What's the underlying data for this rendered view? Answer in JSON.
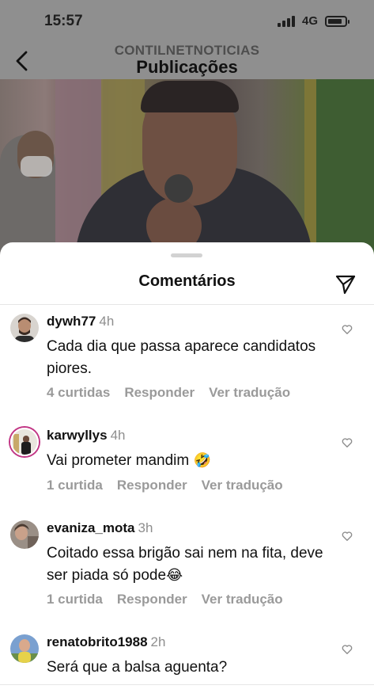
{
  "status_bar": {
    "time": "15:57",
    "network": "4G"
  },
  "header": {
    "account": "CONTILNETNOTICIAS",
    "title": "Publicações"
  },
  "sheet": {
    "title": "Comentários"
  },
  "icons": {
    "back": "chevron-left-icon",
    "share": "paper-plane-icon",
    "like": "heart-outline-icon"
  },
  "colors": {
    "meta_gray": "#9a9a9a",
    "text": "#111111",
    "sheet_bg": "#ffffff"
  },
  "comments": [
    {
      "username": "dywh77",
      "time": "4h",
      "text": "Cada dia que passa aparece candidatos piores.",
      "likes": "4 curtidas",
      "reply": "Responder",
      "translate": "Ver tradução"
    },
    {
      "username": "karwyllys",
      "time": "4h",
      "text": "Vai prometer mandim",
      "emoji": "🤣",
      "likes": "1 curtida",
      "reply": "Responder",
      "translate": "Ver tradução"
    },
    {
      "username": "evaniza_mota",
      "time": "3h",
      "text": "Coitado essa brigão sai nem na fita, deve ser piada só pode",
      "emoji": "😂",
      "likes": "1 curtida",
      "reply": "Responder",
      "translate": "Ver tradução"
    },
    {
      "username": "renatobrito1988",
      "time": "2h",
      "text": "Será que a balsa aguenta?"
    }
  ]
}
